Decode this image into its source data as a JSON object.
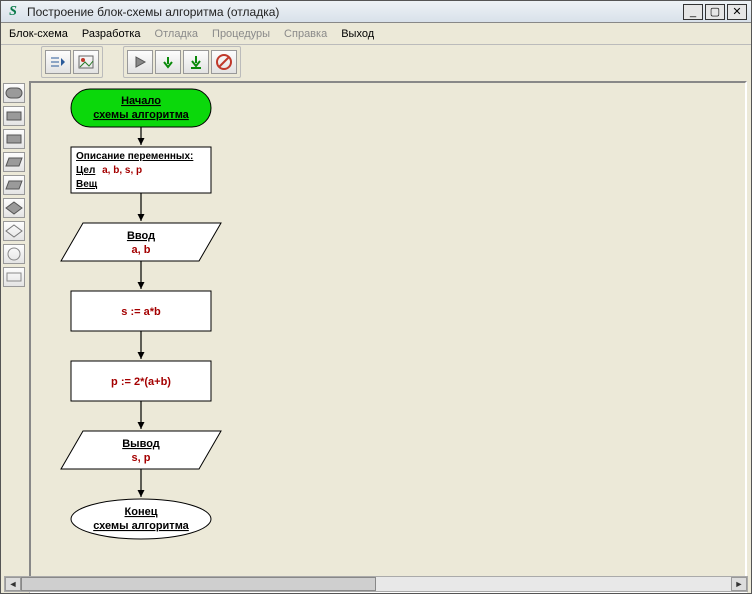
{
  "window": {
    "title": "Построение блок-схемы алгоритма (отладка)",
    "minimize": "_",
    "maximize": "▢",
    "close": "✕"
  },
  "menu": {
    "scheme": "Блок-схема",
    "develop": "Разработка",
    "debug": "Отладка",
    "procedures": "Процедуры",
    "help": "Справка",
    "exit": "Выход"
  },
  "scroll": {
    "left": "◄",
    "right": "►"
  },
  "flowchart": {
    "start": {
      "line1": "Начало",
      "line2": "схемы алгоритма"
    },
    "vars": {
      "title": "Описание переменных:",
      "int_label": "Цел",
      "int_list": "a, b, s, p",
      "real_label": "Вещ"
    },
    "input": {
      "title": "Ввод",
      "args": "a, b"
    },
    "proc1": "s := a*b",
    "proc2": "p := 2*(a+b)",
    "output": {
      "title": "Вывод",
      "args": "s, p"
    },
    "end": {
      "line1": "Конец",
      "line2": "схемы алгоритма"
    }
  },
  "palette_shapes": [
    "terminator",
    "process",
    "process",
    "parallelogram",
    "parallelogram",
    "diamond",
    "diamond",
    "circle",
    "rect"
  ]
}
